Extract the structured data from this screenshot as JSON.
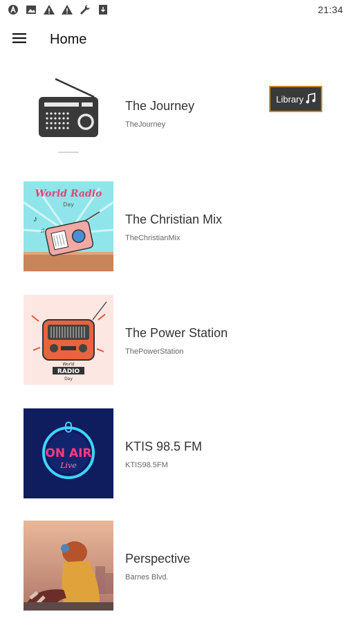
{
  "status_bar": {
    "time": "21:34",
    "icons": [
      "app-a-icon",
      "image-icon",
      "warning-icon",
      "warning-icon",
      "wrench-icon",
      "download-icon"
    ]
  },
  "app_bar": {
    "title": "Home",
    "menu_icon": "hamburger-menu-icon"
  },
  "library_button": {
    "label": "Library",
    "icon": "music-note-icon"
  },
  "stations": [
    {
      "name": "The Journey",
      "subtitle": "TheJourney",
      "thumbnail": "radio-icon"
    },
    {
      "name": "The Christian Mix",
      "subtitle": "TheChristianMix",
      "thumbnail": "world-radio-day-art",
      "art_text": "World Radio",
      "art_text2": "Day"
    },
    {
      "name": "The Power Station",
      "subtitle": "ThePowerStation",
      "thumbnail": "retro-radio-art",
      "art_text": "World",
      "art_text2": "RADIO",
      "art_text3": "Day"
    },
    {
      "name": "KTIS 98.5 FM",
      "subtitle": "KTIS98.5FM",
      "thumbnail": "on-air-neon-art",
      "art_text": "ON AIR",
      "art_text2": "Live"
    },
    {
      "name": "Perspective",
      "subtitle": "Barnes Blvd.",
      "thumbnail": "red-panda-art"
    }
  ],
  "colors": {
    "accent_border": "#d08a1e",
    "button_bg": "#3a3a3a"
  }
}
